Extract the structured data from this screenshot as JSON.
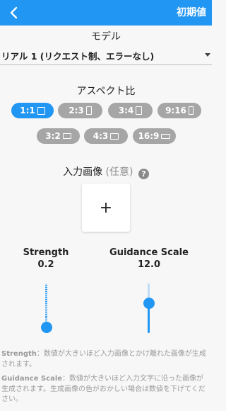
{
  "header": {
    "back_icon": "chevron-left-icon",
    "reset_label": "初期値",
    "color": "#2196f3"
  },
  "model": {
    "heading": "モデル",
    "selected": "リアル 1 (リクエスト制、エラーなし)"
  },
  "aspect": {
    "heading": "アスペクト比",
    "selected": "1:1",
    "options": [
      "1:1",
      "2:3",
      "3:4",
      "9:16",
      "3:2",
      "4:3",
      "16:9"
    ]
  },
  "input_image": {
    "heading": "入力画像",
    "optional": "(任意)",
    "help_icon": "question-circle-icon",
    "add_label": "+"
  },
  "strength": {
    "title": "Strength",
    "value": "0.2",
    "level": 0.0
  },
  "guidance": {
    "title": "Guidance Scale",
    "value": "12.0",
    "level": 0.6
  },
  "description": {
    "strength_term": "Strength",
    "strength_text": "：数値が大きいほど入力画像とかけ離れた画像が生成されます。",
    "guidance_term": "Guidance Scale",
    "guidance_text": "：数値が大きいほど入力文字に沿った画像が生成されます。生成画像の色がおかしい場合は数値を下げてください。"
  }
}
